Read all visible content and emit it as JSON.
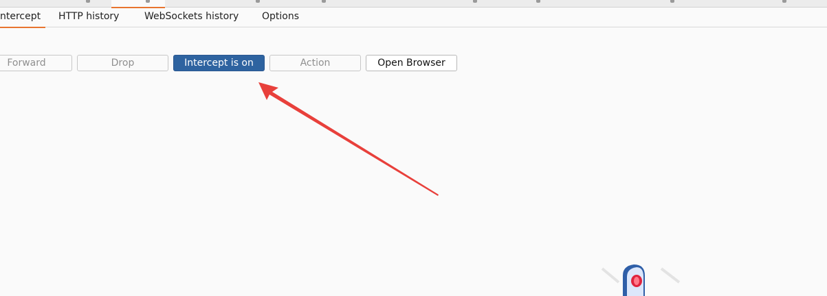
{
  "subtabs": [
    {
      "label": "ntercept",
      "active": true
    },
    {
      "label": "HTTP history",
      "active": false
    },
    {
      "label": "WebSockets history",
      "active": false
    },
    {
      "label": "Options",
      "active": false
    }
  ],
  "toolbar": {
    "forward_label": "Forward",
    "drop_label": "Drop",
    "intercept_label": "Intercept is on",
    "action_label": "Action",
    "open_browser_label": "Open Browser"
  },
  "colors": {
    "accent": "#e8742f",
    "primary_button": "#2e63a0",
    "annotation_arrow": "#e8403b"
  },
  "icons": [
    "annotation-arrow-icon",
    "traffic-light-icon"
  ]
}
